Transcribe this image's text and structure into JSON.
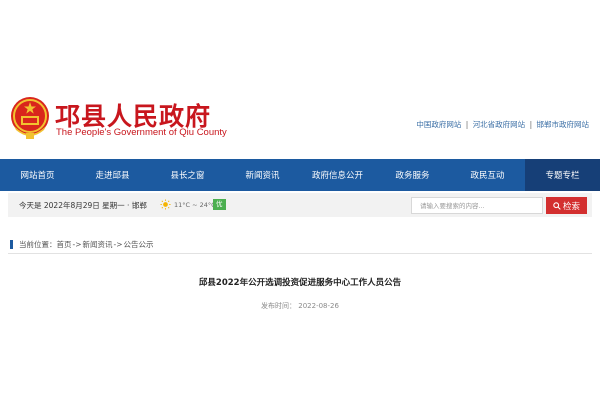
{
  "header": {
    "title_cn": "邛县人民政府",
    "title_en": "The People's Government of Qiu County",
    "emblem_icon": "national-emblem-icon",
    "top_links": [
      "中国政府网站",
      "河北省政府网站",
      "邯郸市政府网站"
    ],
    "top_link_separator": "|"
  },
  "nav": {
    "items": [
      {
        "label": "网站首页"
      },
      {
        "label": "走进邱县"
      },
      {
        "label": "县长之窗"
      },
      {
        "label": "新闻资讯"
      },
      {
        "label": "政府信息公开"
      },
      {
        "label": "政务服务"
      },
      {
        "label": "政民互动"
      },
      {
        "label": "专题专栏"
      }
    ],
    "active_index": 7
  },
  "infobar": {
    "date_text": "今天是 2022年8月29日 星期一 · 邯郸",
    "weather_icon": "sun-icon",
    "temperature": "11°C ~ 24°C",
    "aqi": "优",
    "search_placeholder": "请输入要搜索的内容...",
    "search_button": "检索",
    "search_icon": "search-icon"
  },
  "breadcrumb": {
    "label": "当前位置：",
    "items": [
      "首页",
      "新闻资讯",
      "公告公示"
    ],
    "separator": "->"
  },
  "article": {
    "title": "邱县2022年公开选调投资促进服务中心工作人员公告",
    "publish_label": "发布时间：",
    "publish_date": "2022-08-26"
  },
  "colors": {
    "brand_red": "#c8161d",
    "nav_blue": "#1c5aa0",
    "nav_active": "#163f77",
    "search_red": "#d32f2f",
    "aqi_green": "#4caf50"
  }
}
